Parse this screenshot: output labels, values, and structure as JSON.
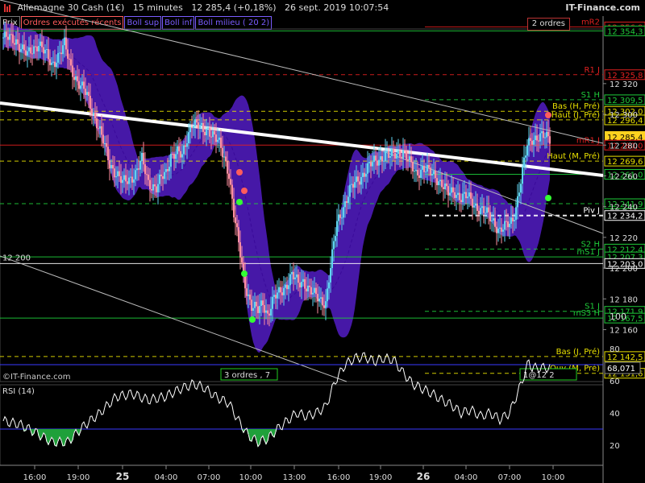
{
  "header": {
    "title": "Allemagne 30 Cash (1€)",
    "timeframe": "15 minutes",
    "price": "12 285,4 (+0,18%)",
    "datetime": "26 sept. 2019 10:07:54",
    "brand": "IT-Finance.com"
  },
  "legend": [
    "Prix",
    "Ordres exécutés récents",
    "Boll sup",
    "Boll inf",
    "Boll milieu ( 20 2)"
  ],
  "watermark": "©IT-Finance.com",
  "orders_badge": "2 ordres",
  "orders_markers": [
    "3 ordres , 7",
    "1@12 2"
  ],
  "colors": {
    "background": "#000000",
    "bollinger_fill": "#5a1fd6",
    "candle_up": "#5fd3f0",
    "candle_down": "#ff8fa0",
    "trendline": "#ffffff",
    "support_green": "#1fcc3a",
    "resistance_red": "#e02020",
    "pivot_yellow": "#e8e000",
    "rsi_line": "#ffffff",
    "current_price_bg": "#ffd21f"
  },
  "chart_data": [
    {
      "type": "candlestick",
      "title": "Allemagne 30 Cash (1€)",
      "ylim": [
        12130,
        12365
      ],
      "y_ticks": [
        12320,
        12300,
        12280,
        12260,
        12240,
        12220,
        12200,
        12180,
        12160
      ],
      "x_tick_labels": [
        "16:00",
        "19:00",
        "25",
        "04:00",
        "07:00",
        "10:00",
        "13:00",
        "16:00",
        "19:00",
        "26",
        "04:00",
        "07:00",
        "10:00"
      ],
      "current_price": "12 285,4",
      "close_path": [
        [
          0,
          12350
        ],
        [
          8,
          12348
        ],
        [
          15,
          12338
        ],
        [
          22,
          12347
        ],
        [
          30,
          12332
        ],
        [
          38,
          12345
        ],
        [
          42,
          12330
        ],
        [
          47,
          12320
        ],
        [
          52,
          12312
        ],
        [
          58,
          12295
        ],
        [
          62,
          12282
        ],
        [
          66,
          12268
        ],
        [
          70,
          12262
        ],
        [
          74,
          12255
        ],
        [
          78,
          12258
        ],
        [
          82,
          12262
        ],
        [
          86,
          12270
        ],
        [
          90,
          12256
        ],
        [
          95,
          12252
        ],
        [
          98,
          12258
        ],
        [
          101,
          12262
        ],
        [
          104,
          12274
        ],
        [
          108,
          12275
        ],
        [
          111,
          12272
        ],
        [
          114,
          12285
        ],
        [
          117,
          12295
        ],
        [
          121,
          12292
        ],
        [
          124,
          12289
        ],
        [
          127,
          12291
        ],
        [
          130,
          12287
        ],
        [
          134,
          12280
        ],
        [
          137,
          12272
        ],
        [
          140,
          12262
        ],
        [
          143,
          12235
        ],
        [
          146,
          12215
        ],
        [
          150,
          12190
        ],
        [
          154,
          12175
        ],
        [
          158,
          12172
        ],
        [
          161,
          12178
        ],
        [
          164,
          12170
        ],
        [
          168,
          12180
        ],
        [
          172,
          12185
        ],
        [
          176,
          12190
        ],
        [
          179,
          12195
        ],
        [
          183,
          12190
        ],
        [
          186,
          12192
        ],
        [
          189,
          12187
        ],
        [
          192,
          12183
        ],
        [
          196,
          12180
        ],
        [
          200,
          12178
        ],
        [
          203,
          12200
        ],
        [
          207,
          12230
        ],
        [
          211,
          12240
        ],
        [
          215,
          12250
        ],
        [
          218,
          12255
        ],
        [
          222,
          12260
        ],
        [
          226,
          12265
        ],
        [
          230,
          12269
        ],
        [
          234,
          12272
        ],
        [
          237,
          12274
        ],
        [
          240,
          12272
        ],
        [
          244,
          12275
        ],
        [
          248,
          12276
        ],
        [
          252,
          12268
        ],
        [
          256,
          12262
        ],
        [
          260,
          12265
        ],
        [
          264,
          12262
        ],
        [
          268,
          12260
        ],
        [
          272,
          12255
        ],
        [
          276,
          12248
        ],
        [
          280,
          12250
        ],
        [
          284,
          12246
        ],
        [
          288,
          12246
        ],
        [
          292,
          12242
        ],
        [
          296,
          12238
        ],
        [
          300,
          12235
        ],
        [
          304,
          12231
        ],
        [
          308,
          12224
        ],
        [
          312,
          12227
        ],
        [
          316,
          12232
        ],
        [
          319,
          12245
        ],
        [
          322,
          12262
        ],
        [
          325,
          12280
        ],
        [
          328,
          12285
        ]
      ],
      "lines": [
        {
          "label": "mR2",
          "value": "12 356,9",
          "color": "red",
          "style": "solid"
        },
        {
          "label": "",
          "value": "12 354,3",
          "color": "green",
          "style": "solid"
        },
        {
          "label": "R1 J",
          "value": "12 325,8",
          "color": "red",
          "style": "dashed"
        },
        {
          "label": "S1 H",
          "value": "12 309,5",
          "color": "green",
          "style": "dashed"
        },
        {
          "label": "Bas (H, Pré)",
          "value": "12 302,0",
          "color": "yellow",
          "style": "dashed"
        },
        {
          "label": "Haut (J, Pré)",
          "value": "12 296,4",
          "color": "yellow",
          "style": "dashed"
        },
        {
          "label": "",
          "value": "12 285,4",
          "color": "current",
          "style": "none"
        },
        {
          "label": "mR1 J",
          "value": "12 280,0",
          "color": "red",
          "style": "solid"
        },
        {
          "label": "Haut (M, Pré)",
          "value": "12 269,6",
          "color": "yellow",
          "style": "dashed"
        },
        {
          "label": "",
          "value": "12 261,0",
          "color": "green",
          "style": "solid"
        },
        {
          "label": "",
          "value": "12 241,9",
          "color": "green",
          "style": "dashed"
        },
        {
          "label": "Piv J",
          "value": "12 234,2",
          "color": "white",
          "style": "dashed"
        },
        {
          "label": "S2 H",
          "value": "12 212,4",
          "color": "green",
          "style": "dashed"
        },
        {
          "label": "mS1 J",
          "value": "12 207,3",
          "color": "green",
          "style": "solid"
        },
        {
          "label": "",
          "value": "12 203,0",
          "color": "white",
          "style": "solid"
        },
        {
          "label": "S1 J",
          "value": "12 171,9",
          "color": "green",
          "style": "dashed"
        },
        {
          "label": "mS3 H",
          "value": "12 167,5",
          "color": "green",
          "style": "solid"
        },
        {
          "label": "Bas (J, Pré)",
          "value": "12 142,5",
          "color": "yellow",
          "style": "dashed"
        },
        {
          "label": "Ouv (M, Pré)",
          "value": "12 131,6",
          "color": "yellow",
          "style": "dashed"
        }
      ],
      "left_level_label": "12 200"
    },
    {
      "type": "line",
      "title": "RSI (14)",
      "ylim": [
        0,
        100
      ],
      "y_ticks": [
        100,
        80,
        60,
        40,
        20
      ],
      "bands": [
        70,
        30
      ],
      "current_value": "68,071",
      "values": [
        [
          0,
          35
        ],
        [
          10,
          33
        ],
        [
          20,
          28
        ],
        [
          30,
          22
        ],
        [
          40,
          22
        ],
        [
          50,
          32
        ],
        [
          60,
          40
        ],
        [
          70,
          50
        ],
        [
          80,
          52
        ],
        [
          90,
          48
        ],
        [
          100,
          50
        ],
        [
          110,
          55
        ],
        [
          118,
          58
        ],
        [
          124,
          56
        ],
        [
          132,
          50
        ],
        [
          140,
          46
        ],
        [
          146,
          35
        ],
        [
          152,
          26
        ],
        [
          158,
          22
        ],
        [
          164,
          24
        ],
        [
          170,
          30
        ],
        [
          176,
          35
        ],
        [
          182,
          40
        ],
        [
          188,
          38
        ],
        [
          194,
          40
        ],
        [
          200,
          44
        ],
        [
          206,
          60
        ],
        [
          212,
          70
        ],
        [
          218,
          74
        ],
        [
          224,
          75
        ],
        [
          230,
          72
        ],
        [
          236,
          74
        ],
        [
          242,
          73
        ],
        [
          248,
          65
        ],
        [
          254,
          58
        ],
        [
          260,
          55
        ],
        [
          266,
          52
        ],
        [
          272,
          48
        ],
        [
          278,
          45
        ],
        [
          284,
          40
        ],
        [
          290,
          42
        ],
        [
          296,
          38
        ],
        [
          302,
          40
        ],
        [
          308,
          36
        ],
        [
          314,
          40
        ],
        [
          320,
          55
        ],
        [
          326,
          72
        ],
        [
          328,
          68
        ]
      ]
    }
  ]
}
